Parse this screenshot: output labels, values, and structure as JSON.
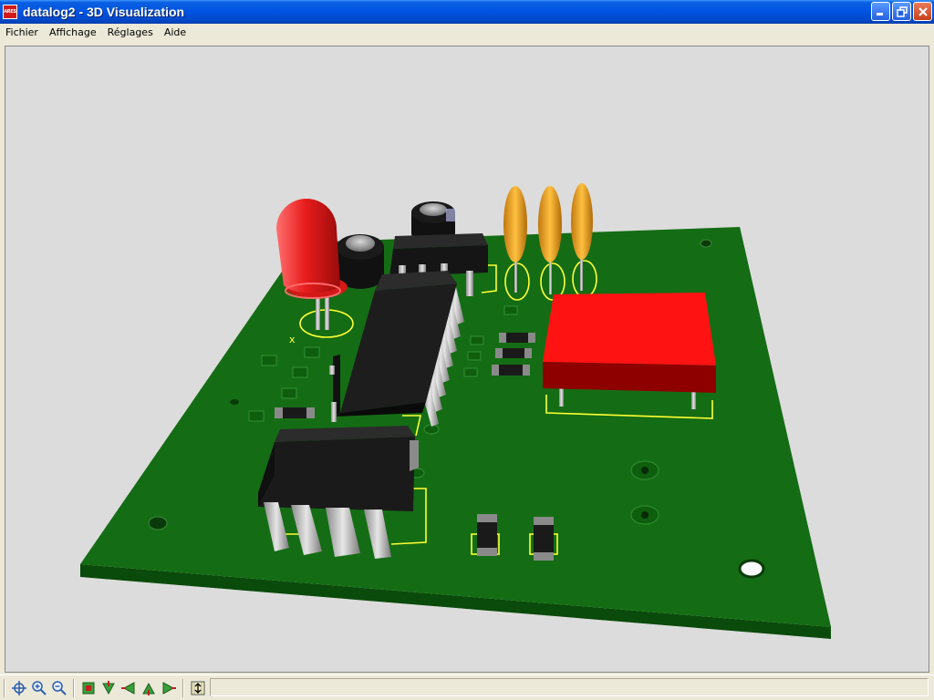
{
  "window": {
    "title": "datalog2 - 3D Visualization",
    "logo_text": "ARES",
    "accent": "#0054e3"
  },
  "menu": {
    "items": [
      {
        "label": "Fichier"
      },
      {
        "label": "Affichage"
      },
      {
        "label": "Réglages"
      },
      {
        "label": "Aide"
      }
    ]
  },
  "scene": {
    "background": "#dcdcdc",
    "board_color": "#126b12",
    "silkscreen_color": "#ffff33",
    "led_color": "#e02020",
    "relay_color": "#ff1010",
    "capacitor_color": "#f0a020",
    "silk_marker": "x"
  },
  "toolbar": {
    "buttons": [
      {
        "icon": "pan-icon"
      },
      {
        "icon": "zoom-in-icon"
      },
      {
        "icon": "zoom-out-icon"
      },
      {
        "icon": "view-top-icon"
      },
      {
        "icon": "view-front-icon"
      },
      {
        "icon": "view-left-icon"
      },
      {
        "icon": "view-back-icon"
      },
      {
        "icon": "view-right-icon"
      },
      {
        "icon": "height-scale-icon"
      }
    ]
  }
}
